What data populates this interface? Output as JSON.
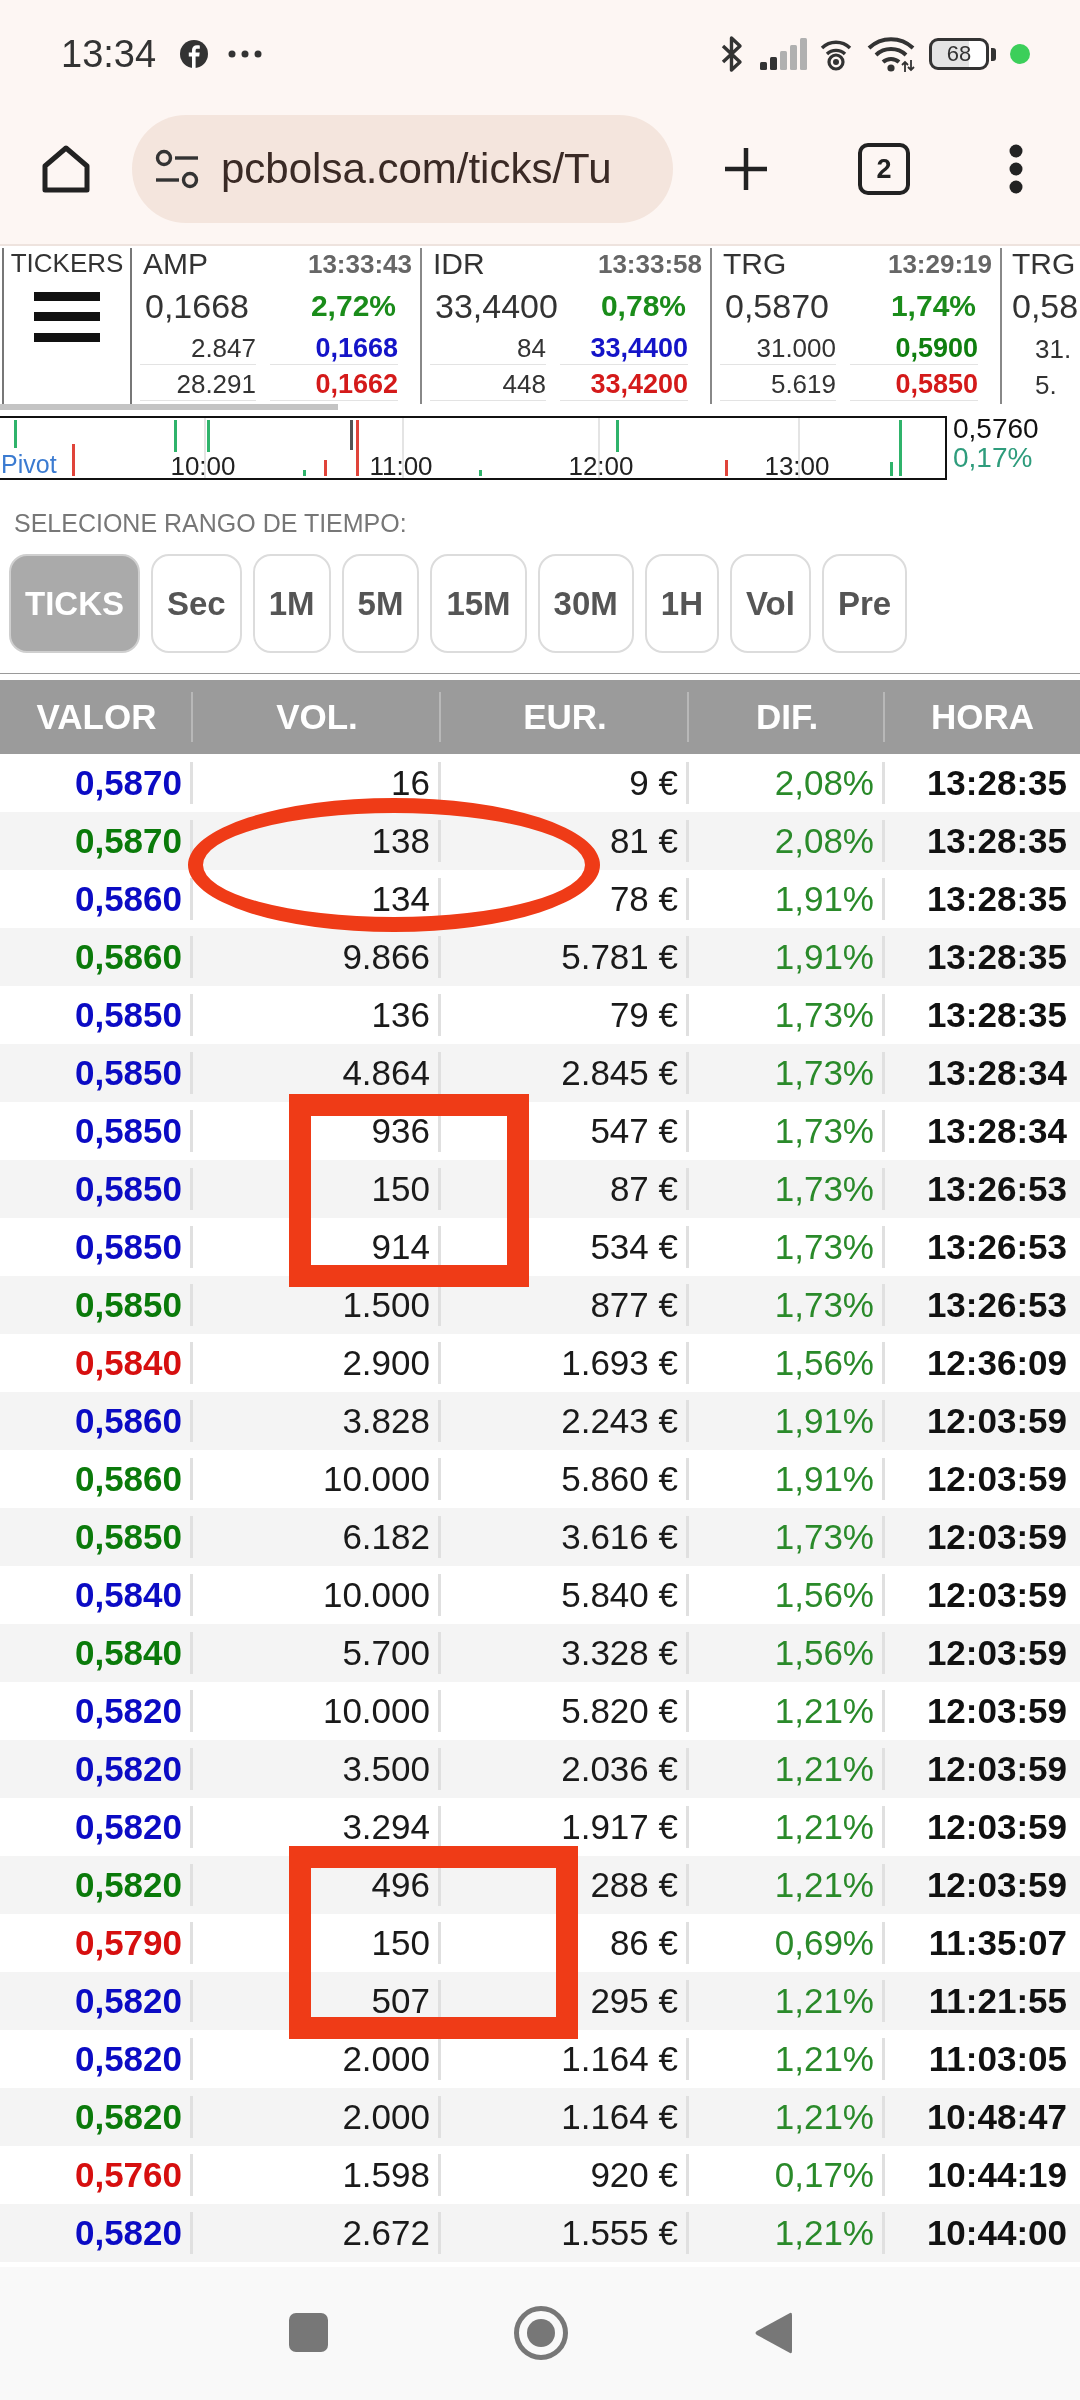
{
  "status_bar": {
    "time": "13:34",
    "battery": "68"
  },
  "browser": {
    "url": "pcbolsa.com/ticks/Tu",
    "tab_count": "2"
  },
  "tickers": {
    "label": "TICKERS",
    "items": [
      {
        "symbol": "AMP",
        "time": "13:33:43",
        "price": "0,1668",
        "change": "2,72%",
        "upper_volume": "2.847",
        "upper_price": {
          "value": "0,1668",
          "color": "#1414c8"
        },
        "lower_volume": "28.291",
        "lower_price": {
          "value": "0,1662",
          "color": "#d41a1a"
        }
      },
      {
        "symbol": "IDR",
        "time": "13:33:58",
        "price": "33,4400",
        "change": "0,78%",
        "upper_volume": "84",
        "upper_price": {
          "value": "33,4400",
          "color": "#1414c8"
        },
        "lower_volume": "448",
        "lower_price": {
          "value": "33,4200",
          "color": "#d41a1a"
        }
      },
      {
        "symbol": "TRG",
        "time": "13:29:19",
        "price": "0,5870",
        "change": "1,74%",
        "upper_volume": "31.000",
        "upper_price": {
          "value": "0,5900",
          "color": "#0f7f0f"
        },
        "lower_volume": "5.619",
        "lower_price": {
          "value": "0,5850",
          "color": "#d41a1a"
        }
      },
      {
        "symbol": "TRG",
        "price": "0,58",
        "upper_volume": "31.",
        "lower_volume": "5."
      }
    ]
  },
  "pivot_chart": {
    "label": "Pivot",
    "time_labels": [
      "10:00",
      "11:00",
      "12:00",
      "13:00"
    ],
    "last_price": "0,5760",
    "last_change": "0,17%"
  },
  "range_selector": {
    "label": "SELECIONE RANGO DE TIEMPO:",
    "buttons": [
      {
        "label": "TICKS",
        "selected": true
      },
      {
        "label": "Sec",
        "selected": false
      },
      {
        "label": "1M",
        "selected": false
      },
      {
        "label": "5M",
        "selected": false
      },
      {
        "label": "15M",
        "selected": false
      },
      {
        "label": "30M",
        "selected": false
      },
      {
        "label": "1H",
        "selected": false
      },
      {
        "label": "Vol",
        "selected": false
      },
      {
        "label": "Pre",
        "selected": false
      }
    ]
  },
  "table": {
    "columns": [
      "VALOR",
      "VOL.",
      "EUR.",
      "DIF.",
      "HORA"
    ],
    "rows": [
      {
        "color": "#0b0bc4",
        "cells": [
          "0,5870",
          "16",
          "9 €",
          "2,08%",
          "13:28:35"
        ]
      },
      {
        "color": "#0a7a0a",
        "cells": [
          "0,5870",
          "138",
          "81 €",
          "2,08%",
          "13:28:35"
        ]
      },
      {
        "color": "#0b0bc4",
        "cells": [
          "0,5860",
          "134",
          "78 €",
          "1,91%",
          "13:28:35"
        ]
      },
      {
        "color": "#0a7a0a",
        "cells": [
          "0,5860",
          "9.866",
          "5.781 €",
          "1,91%",
          "13:28:35"
        ]
      },
      {
        "color": "#0b0bc4",
        "cells": [
          "0,5850",
          "136",
          "79 €",
          "1,73%",
          "13:28:35"
        ]
      },
      {
        "color": "#0b0bc4",
        "cells": [
          "0,5850",
          "4.864",
          "2.845 €",
          "1,73%",
          "13:28:34"
        ]
      },
      {
        "color": "#0b0bc4",
        "cells": [
          "0,5850",
          "936",
          "547 €",
          "1,73%",
          "13:28:34"
        ]
      },
      {
        "color": "#0b0bc4",
        "cells": [
          "0,5850",
          "150",
          "87 €",
          "1,73%",
          "13:26:53"
        ]
      },
      {
        "color": "#0b0bc4",
        "cells": [
          "0,5850",
          "914",
          "534 €",
          "1,73%",
          "13:26:53"
        ]
      },
      {
        "color": "#0a7a0a",
        "cells": [
          "0,5850",
          "1.500",
          "877 €",
          "1,73%",
          "13:26:53"
        ]
      },
      {
        "color": "#d60f0f",
        "cells": [
          "0,5840",
          "2.900",
          "1.693 €",
          "1,56%",
          "12:36:09"
        ]
      },
      {
        "color": "#0b0bc4",
        "cells": [
          "0,5860",
          "3.828",
          "2.243 €",
          "1,91%",
          "12:03:59"
        ]
      },
      {
        "color": "#0a7a0a",
        "cells": [
          "0,5860",
          "10.000",
          "5.860 €",
          "1,91%",
          "12:03:59"
        ]
      },
      {
        "color": "#0a7a0a",
        "cells": [
          "0,5850",
          "6.182",
          "3.616 €",
          "1,73%",
          "12:03:59"
        ]
      },
      {
        "color": "#0b0bc4",
        "cells": [
          "0,5840",
          "10.000",
          "5.840 €",
          "1,56%",
          "12:03:59"
        ]
      },
      {
        "color": "#0a7a0a",
        "cells": [
          "0,5840",
          "5.700",
          "3.328 €",
          "1,56%",
          "12:03:59"
        ]
      },
      {
        "color": "#0b0bc4",
        "cells": [
          "0,5820",
          "10.000",
          "5.820 €",
          "1,21%",
          "12:03:59"
        ]
      },
      {
        "color": "#0b0bc4",
        "cells": [
          "0,5820",
          "3.500",
          "2.036 €",
          "1,21%",
          "12:03:59"
        ]
      },
      {
        "color": "#0b0bc4",
        "cells": [
          "0,5820",
          "3.294",
          "1.917 €",
          "1,21%",
          "12:03:59"
        ]
      },
      {
        "color": "#0a7a0a",
        "cells": [
          "0,5820",
          "496",
          "288 €",
          "1,21%",
          "12:03:59"
        ]
      },
      {
        "color": "#d60f0f",
        "cells": [
          "0,5790",
          "150",
          "86 €",
          "0,69%",
          "11:35:07"
        ]
      },
      {
        "color": "#0b0bc4",
        "cells": [
          "0,5820",
          "507",
          "295 €",
          "1,21%",
          "11:21:55"
        ]
      },
      {
        "color": "#0b0bc4",
        "cells": [
          "0,5820",
          "2.000",
          "1.164 €",
          "1,21%",
          "11:03:05"
        ]
      },
      {
        "color": "#0a7a0a",
        "cells": [
          "0,5820",
          "2.000",
          "1.164 €",
          "1,21%",
          "10:48:47"
        ]
      },
      {
        "color": "#d60f0f",
        "cells": [
          "0,5760",
          "1.598",
          "920 €",
          "0,17%",
          "10:44:19"
        ]
      },
      {
        "color": "#0b0bc4",
        "cells": [
          "0,5820",
          "2.672",
          "1.555 €",
          "1,21%",
          "10:44:00"
        ]
      }
    ]
  },
  "annotations": [
    {
      "kind": "ellipse"
    },
    {
      "kind": "rectangle"
    },
    {
      "kind": "rectangle"
    }
  ]
}
